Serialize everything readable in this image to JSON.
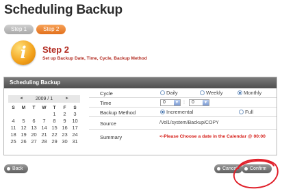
{
  "page": {
    "title": "Scheduling Backup"
  },
  "steps": [
    {
      "label": "Step 1",
      "state": "inactive"
    },
    {
      "label": "Step 2",
      "state": "active"
    }
  ],
  "step_header": {
    "icon": "info-icon",
    "title": "Step 2",
    "subtitle": "Set up Backup Date, Time, Cycle, Backup Method"
  },
  "panel": {
    "title": "Scheduling Backup"
  },
  "calendar": {
    "month_label": "2009 / 1",
    "day_headers": [
      "S",
      "M",
      "T",
      "W",
      "T",
      "F",
      "S"
    ],
    "weeks": [
      [
        "",
        "",
        "",
        "",
        "1",
        "2",
        "3"
      ],
      [
        "4",
        "5",
        "6",
        "7",
        "8",
        "9",
        "10"
      ],
      [
        "11",
        "12",
        "13",
        "14",
        "15",
        "16",
        "17"
      ],
      [
        "18",
        "19",
        "20",
        "21",
        "22",
        "23",
        "24"
      ],
      [
        "25",
        "26",
        "27",
        "28",
        "29",
        "30",
        "31"
      ]
    ]
  },
  "form": {
    "cycle": {
      "label": "Cycle",
      "options": [
        "Daily",
        "Weekly",
        "Monthly"
      ],
      "selected": "Monthly"
    },
    "time": {
      "label": "Time",
      "hour": "0",
      "minute": "0",
      "separator": ":"
    },
    "method": {
      "label": "Backup Method",
      "options": [
        "Incremental",
        "Full"
      ],
      "selected": "Incremental"
    },
    "source": {
      "label": "Source",
      "value": "/Vol1/system/Backup/COPY"
    },
    "summary": {
      "label": "Summary",
      "value": "<-Please Choose a date in the Calendar @ 00:00"
    }
  },
  "buttons": {
    "back": "Back",
    "cancel": "Cancel",
    "confirm": "Confirm"
  },
  "colors": {
    "active_step": "#e2701c",
    "header_bar": "#5a5a5a",
    "accent_red": "#b22a20",
    "annotation": "#e0202a"
  }
}
